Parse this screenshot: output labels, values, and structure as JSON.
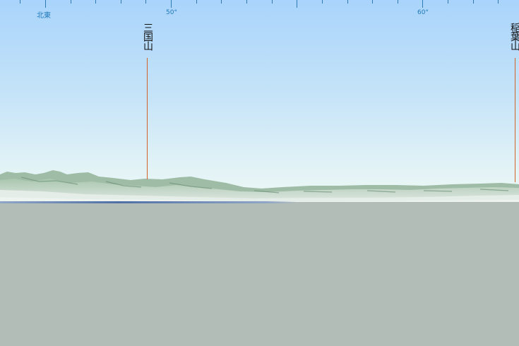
{
  "compass": {
    "direction_label": "北東",
    "degree_labels": [
      "50°",
      "60°"
    ]
  },
  "peaks": [
    {
      "name": "三国山"
    },
    {
      "name": "稲葉山"
    }
  ],
  "colors": {
    "sky_top": "#a9d4fb",
    "sky_horizon": "#eef8f4",
    "ground": "#b2bdb8",
    "terrain": "#9fbfa7",
    "peak_line": "#d2622a",
    "compass": "#1f78b8"
  }
}
